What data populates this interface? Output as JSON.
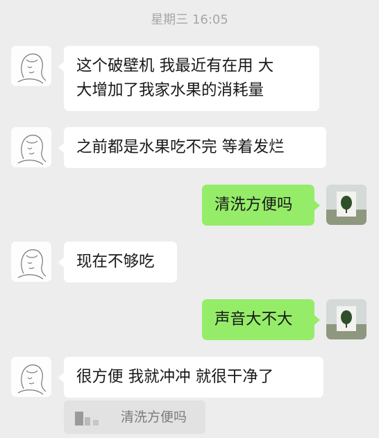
{
  "chat": {
    "timestamp": "星期三 16:05",
    "messages": [
      {
        "side": "left",
        "lines": [
          "这个破壁机  我最近有在用  大",
          "大增加了我家水果的消耗量"
        ]
      },
      {
        "side": "left",
        "lines": [
          "之前都是水果吃不完  等着发烂"
        ]
      },
      {
        "side": "right",
        "lines": [
          "清洗方便吗"
        ]
      },
      {
        "side": "left",
        "lines": [
          "现在不够吃"
        ]
      },
      {
        "side": "right",
        "lines": [
          "声音大不大"
        ]
      },
      {
        "side": "left",
        "lines": [
          "很方便   我就冲冲  就很干净了"
        ]
      }
    ],
    "quote": {
      "text": "清洗方便吗"
    }
  },
  "icons": {
    "left_avatar": "sketch-girl-avatar-icon",
    "right_avatar": "tree-photo-avatar-icon"
  },
  "colors": {
    "background": "#ededed",
    "incoming_bubble": "#ffffff",
    "outgoing_bubble": "#95ec69",
    "timestamp": "#a6a6a6"
  }
}
